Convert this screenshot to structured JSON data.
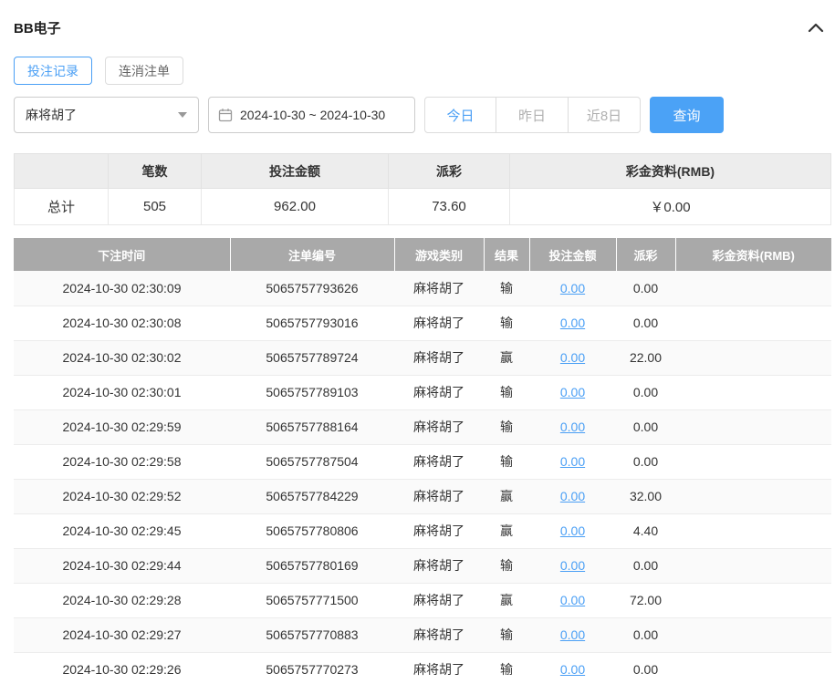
{
  "header": {
    "title": "BB电子"
  },
  "tabs": [
    {
      "label": "投注记录",
      "active": true
    },
    {
      "label": "连消注单",
      "active": false
    }
  ],
  "filters": {
    "game_select_value": "麻将胡了",
    "date_range": "2024-10-30 ~ 2024-10-30",
    "quick_buttons": [
      {
        "label": "今日",
        "active": true
      },
      {
        "label": "昨日",
        "active": false
      },
      {
        "label": "近8日",
        "active": false
      }
    ],
    "search_label": "查询"
  },
  "summary": {
    "headers": [
      "",
      "笔数",
      "投注金额",
      "派彩",
      "彩金资料(RMB)"
    ],
    "row_label": "总计",
    "count": "505",
    "bet_amount": "962.00",
    "payout": "73.60",
    "bonus": "￥0.00"
  },
  "table": {
    "headers": [
      "下注时间",
      "注单编号",
      "游戏类别",
      "结果",
      "投注金额",
      "派彩",
      "彩金资料(RMB)"
    ],
    "rows": [
      [
        "2024-10-30 02:30:09",
        "5065757793626",
        "麻将胡了",
        "输",
        "0.00",
        "0.00",
        ""
      ],
      [
        "2024-10-30 02:30:08",
        "5065757793016",
        "麻将胡了",
        "输",
        "0.00",
        "0.00",
        ""
      ],
      [
        "2024-10-30 02:30:02",
        "5065757789724",
        "麻将胡了",
        "赢",
        "0.00",
        "22.00",
        ""
      ],
      [
        "2024-10-30 02:30:01",
        "5065757789103",
        "麻将胡了",
        "输",
        "0.00",
        "0.00",
        ""
      ],
      [
        "2024-10-30 02:29:59",
        "5065757788164",
        "麻将胡了",
        "输",
        "0.00",
        "0.00",
        ""
      ],
      [
        "2024-10-30 02:29:58",
        "5065757787504",
        "麻将胡了",
        "输",
        "0.00",
        "0.00",
        ""
      ],
      [
        "2024-10-30 02:29:52",
        "5065757784229",
        "麻将胡了",
        "赢",
        "0.00",
        "32.00",
        ""
      ],
      [
        "2024-10-30 02:29:45",
        "5065757780806",
        "麻将胡了",
        "赢",
        "0.00",
        "4.40",
        ""
      ],
      [
        "2024-10-30 02:29:44",
        "5065757780169",
        "麻将胡了",
        "输",
        "0.00",
        "0.00",
        ""
      ],
      [
        "2024-10-30 02:29:28",
        "5065757771500",
        "麻将胡了",
        "赢",
        "0.00",
        "72.00",
        ""
      ],
      [
        "2024-10-30 02:29:27",
        "5065757770883",
        "麻将胡了",
        "输",
        "0.00",
        "0.00",
        ""
      ],
      [
        "2024-10-30 02:29:26",
        "5065757770273",
        "麻将胡了",
        "输",
        "0.00",
        "0.00",
        ""
      ]
    ]
  },
  "colors": {
    "accent": "#4a9ff5",
    "search_button_bg": "#4ba2f6",
    "table_header_bg": "#a9a9a9",
    "summary_header_bg": "#ededed"
  }
}
